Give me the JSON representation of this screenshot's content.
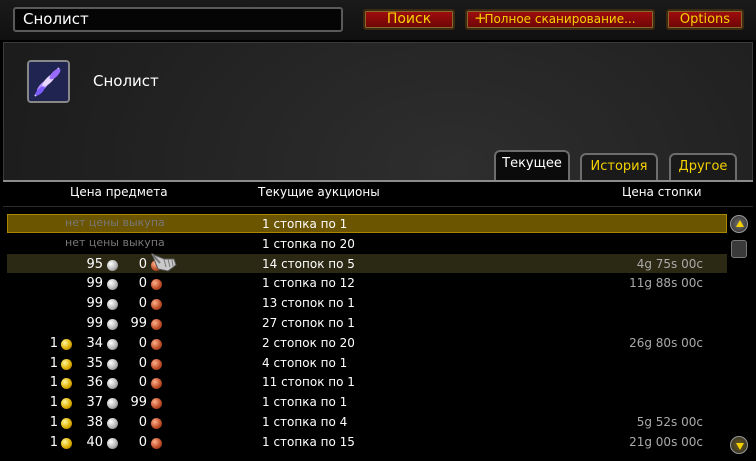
{
  "search": {
    "value": "Снолист"
  },
  "buttons": {
    "search_label": "Поиск",
    "scan_label": "Полное сканирование...",
    "scan_plus": "+",
    "options_label": "Options"
  },
  "item": {
    "name": "Снолист",
    "icon": "snowleaf-herb-icon"
  },
  "tabs": [
    {
      "label": "Текущее",
      "active": true
    },
    {
      "label": "История",
      "active": false
    },
    {
      "label": "Другое",
      "active": false
    }
  ],
  "columns": {
    "price": "Цена предмета",
    "auctions": "Текущие аукционы",
    "stack_price": "Цена стопки"
  },
  "rows": [
    {
      "no_price": "нет цены выкупа",
      "auctions": "1 стопка по 1",
      "stack_price": "",
      "state": "selected"
    },
    {
      "no_price": "нет цены выкупа",
      "auctions": "1 стопка по 20",
      "stack_price": ""
    },
    {
      "gold": "",
      "silver": "95",
      "copper": "0",
      "auctions": "14 стопок по 5",
      "stack_price": "4g 75s 00c",
      "state": "hover"
    },
    {
      "gold": "",
      "silver": "99",
      "copper": "0",
      "auctions": "1 стопка по 12",
      "stack_price": "11g 88s 00c"
    },
    {
      "gold": "",
      "silver": "99",
      "copper": "0",
      "auctions": "13 стопок по 1",
      "stack_price": ""
    },
    {
      "gold": "",
      "silver": "99",
      "copper": "99",
      "auctions": "27 стопок по 1",
      "stack_price": ""
    },
    {
      "gold": "1",
      "silver": "34",
      "copper": "0",
      "auctions": "2 стопок по 20",
      "stack_price": "26g 80s 00c"
    },
    {
      "gold": "1",
      "silver": "35",
      "copper": "0",
      "auctions": "4 стопок по 1",
      "stack_price": ""
    },
    {
      "gold": "1",
      "silver": "36",
      "copper": "0",
      "auctions": "11 стопок по 1",
      "stack_price": ""
    },
    {
      "gold": "1",
      "silver": "37",
      "copper": "99",
      "auctions": "1 стопка по 1",
      "stack_price": ""
    },
    {
      "gold": "1",
      "silver": "38",
      "copper": "0",
      "auctions": "1 стопка по 4",
      "stack_price": "5g 52s 00c"
    },
    {
      "gold": "1",
      "silver": "40",
      "copper": "0",
      "auctions": "1 стопка по 15",
      "stack_price": "21g 00s 00c"
    }
  ],
  "colors": {
    "button_text": "#f5d100",
    "button_bg": "#a10d0d",
    "selected_row": "#6b5500"
  }
}
